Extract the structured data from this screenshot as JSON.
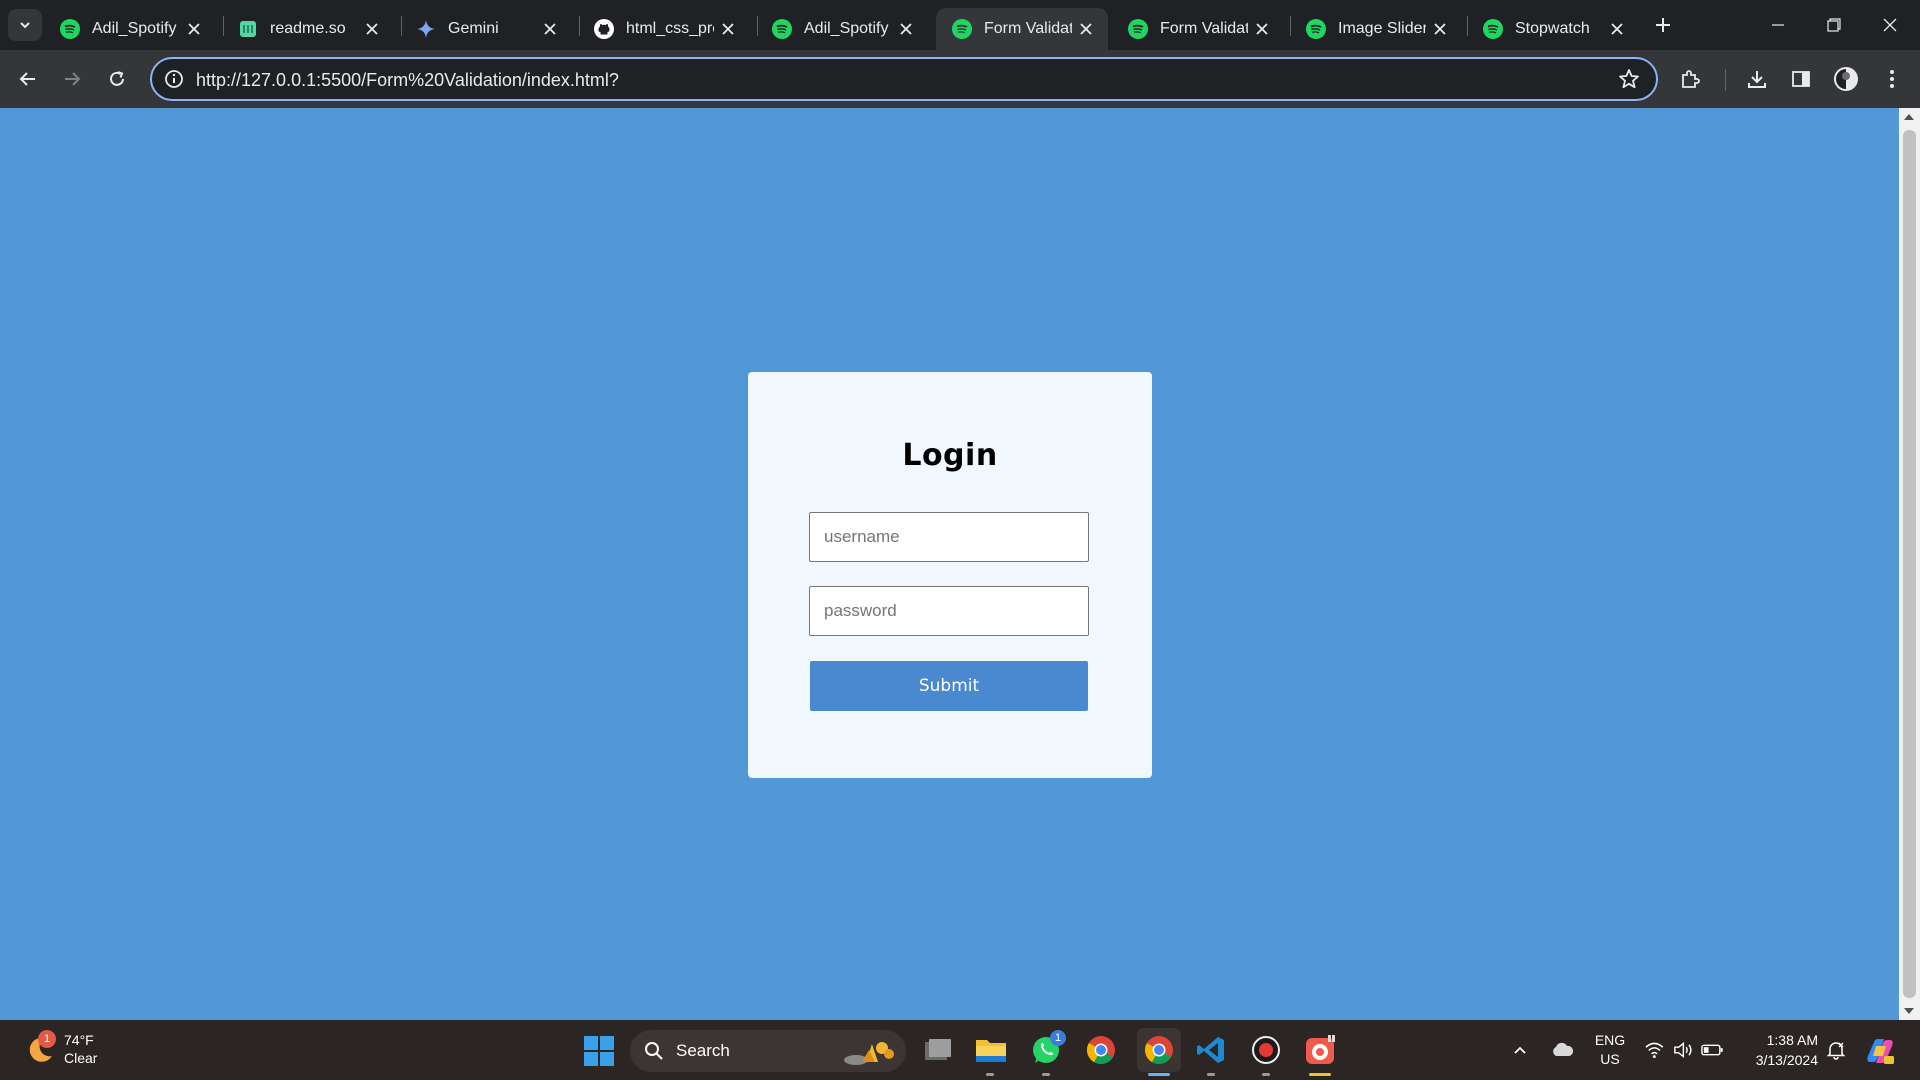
{
  "browser": {
    "tabs": [
      {
        "title": "Adil_Spotify",
        "icon": "spotify-icon"
      },
      {
        "title": "readme.so",
        "icon": "readme-icon"
      },
      {
        "title": "Gemini",
        "icon": "gemini-icon"
      },
      {
        "title": "html_css_proj",
        "icon": "github-icon"
      },
      {
        "title": "Adil_Spotify",
        "icon": "spotify-icon"
      },
      {
        "title": "Form Validati",
        "icon": "spotify-icon",
        "active": true
      },
      {
        "title": "Form Validati",
        "icon": "spotify-icon"
      },
      {
        "title": "Image Slider",
        "icon": "spotify-icon"
      },
      {
        "title": "Stopwatch",
        "icon": "spotify-icon"
      }
    ],
    "url": "http://127.0.0.1:5500/Form%20Validation/index.html?"
  },
  "page": {
    "background": "#5297d6",
    "login": {
      "title": "Login",
      "username_placeholder": "username",
      "password_placeholder": "password",
      "submit_label": "Submit"
    }
  },
  "taskbar": {
    "weather": {
      "temp": "74°F",
      "condition": "Clear",
      "badge": "1"
    },
    "search_label": "Search",
    "apps": [
      "task-view-icon",
      "file-explorer-icon",
      "whatsapp-icon",
      "chrome-icon",
      "chrome-icon",
      "vscode-icon",
      "recorder-icon",
      "camera-app-icon"
    ],
    "whatsapp_badge": "1",
    "language": {
      "line1": "ENG",
      "line2": "US"
    },
    "clock": {
      "time": "1:38 AM",
      "date": "3/13/2024"
    }
  },
  "colors": {
    "accent": "#4a89d0",
    "spotify": "#1ed760",
    "titlebar": "#202124"
  }
}
